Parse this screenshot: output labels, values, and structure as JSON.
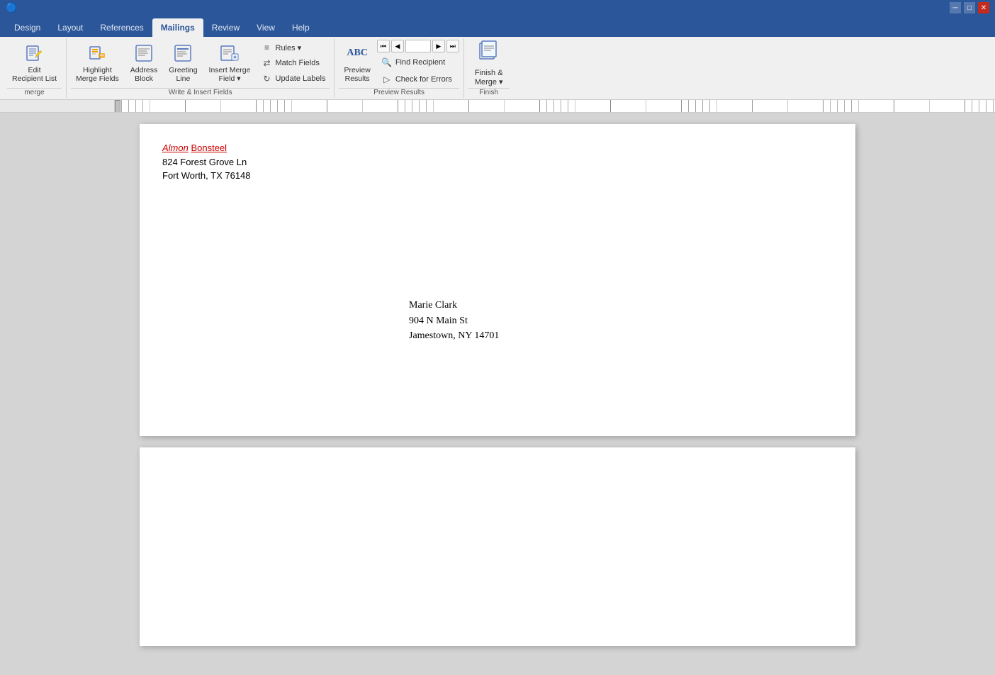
{
  "titleBar": {
    "windowControls": [
      "─",
      "□",
      "✕"
    ]
  },
  "ribbon": {
    "tabs": [
      {
        "id": "design",
        "label": "Design",
        "active": false
      },
      {
        "id": "layout",
        "label": "Layout",
        "active": false
      },
      {
        "id": "references",
        "label": "References",
        "active": false
      },
      {
        "id": "mailings",
        "label": "Mailings",
        "active": true
      },
      {
        "id": "review",
        "label": "Review",
        "active": false
      },
      {
        "id": "view",
        "label": "View",
        "active": false
      },
      {
        "id": "help",
        "label": "Help",
        "active": false
      }
    ],
    "groups": {
      "startMailMerge": {
        "label": "Start Mail Merge",
        "items": [
          {
            "id": "edit-recipient-list",
            "icon": "✏",
            "label": "Edit\nRecipient List"
          }
        ]
      },
      "writeInsertFields": {
        "label": "Write & Insert Fields",
        "items": [
          {
            "id": "highlight-merge-fields",
            "icon": "🖊",
            "label": "Highlight\nMerge Fields"
          },
          {
            "id": "address-block",
            "icon": "📄",
            "label": "Address\nBlock"
          },
          {
            "id": "greeting-line",
            "icon": "📄",
            "label": "Greeting\nLine"
          },
          {
            "id": "insert-merge-field",
            "icon": "📄",
            "label": "Insert Merge\nField"
          }
        ],
        "smallItems": [
          {
            "id": "rules",
            "icon": "≡",
            "label": "Rules ▾"
          },
          {
            "id": "match-fields",
            "icon": "⇄",
            "label": "Match Fields"
          },
          {
            "id": "update-labels",
            "icon": "↻",
            "label": "Update Labels"
          }
        ]
      },
      "previewResults": {
        "label": "Preview Results",
        "navFirst": "⏮",
        "navPrev": "◀",
        "navNext": "▶",
        "navLast": "⏭",
        "navValue": "",
        "items": [
          {
            "id": "preview-results",
            "icon": "ABC",
            "label": "Preview\nResults"
          }
        ],
        "smallItems": [
          {
            "id": "find-recipient",
            "icon": "🔍",
            "label": "Find Recipient"
          },
          {
            "id": "check-for-errors",
            "icon": "▷",
            "label": "Check for Errors"
          }
        ]
      },
      "finish": {
        "label": "Finish",
        "items": [
          {
            "id": "finish-merge",
            "icon": "📋",
            "label": "Finish &\nMerge ▾"
          }
        ]
      }
    }
  },
  "document": {
    "page1": {
      "returnAddress": {
        "firstName": "Almon",
        "lastName": "Bonsteel",
        "street": "824 Forest Grove Ln",
        "cityStateZip": "Fort Worth, TX 76148"
      },
      "recipientAddress": {
        "name": "Marie Clark",
        "street": "904 N Main St",
        "cityStateZip": "Jamestown, NY 14701"
      }
    }
  },
  "sectionLabels": {
    "merge": "merge",
    "writeInsertFields": "Write & Insert Fields",
    "previewResults": "Preview Results",
    "finish": "Finish"
  }
}
